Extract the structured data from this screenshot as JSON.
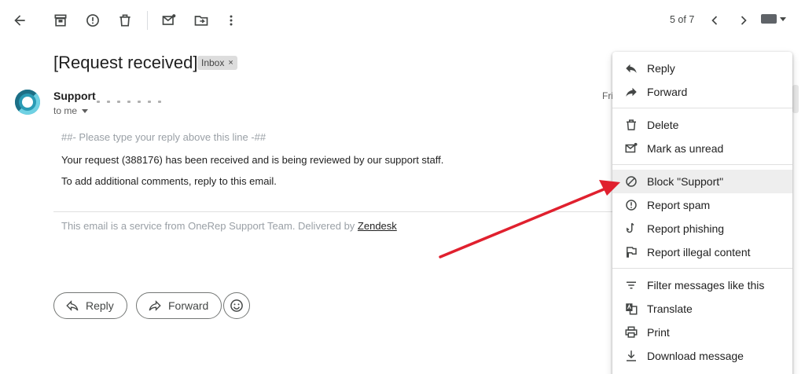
{
  "toolbar": {
    "pager": "5 of 7",
    "icons": [
      "back-arrow-icon",
      "archive-icon",
      "report-spam-icon",
      "delete-icon",
      "mark-unread-icon",
      "move-to-icon",
      "more-vert-icon",
      "chevron-left-icon",
      "chevron-right-icon",
      "keyboard-icon"
    ]
  },
  "email": {
    "subject": "[Request received]",
    "label": "Inbox",
    "label_close": "×",
    "sender_name": "Support",
    "recipient": "to me",
    "date_partial": "Fri",
    "hint_line": "##- Please type your reply above this line -##",
    "body_1": "Your request (388176) has been received and is being reviewed by our support staff.",
    "body_2": "To add additional comments, reply to this email.",
    "footer_text": "This email is a service from OneRep Support Team. Delivered by ",
    "footer_link": "Zendesk"
  },
  "actions": {
    "reply": "Reply",
    "forward": "Forward"
  },
  "menu": {
    "groups": [
      [
        {
          "label": "Reply",
          "icon": "reply-icon"
        },
        {
          "label": "Forward",
          "icon": "forward-icon"
        }
      ],
      [
        {
          "label": "Delete",
          "icon": "delete-icon"
        },
        {
          "label": "Mark as unread",
          "icon": "mark-unread-icon"
        }
      ],
      [
        {
          "label": "Block \"Support\"",
          "icon": "block-icon"
        },
        {
          "label": "Report spam",
          "icon": "report-spam-icon"
        },
        {
          "label": "Report phishing",
          "icon": "phishing-hook-icon"
        },
        {
          "label": "Report illegal content",
          "icon": "flag-icon"
        }
      ],
      [
        {
          "label": "Filter messages like this",
          "icon": "filter-icon"
        },
        {
          "label": "Translate",
          "icon": "translate-icon"
        },
        {
          "label": "Print",
          "icon": "print-icon"
        },
        {
          "label": "Download message",
          "icon": "download-icon"
        }
      ]
    ],
    "highlighted": "Block \"Support\""
  },
  "annotation": {
    "arrow_color": "#e0202e"
  }
}
